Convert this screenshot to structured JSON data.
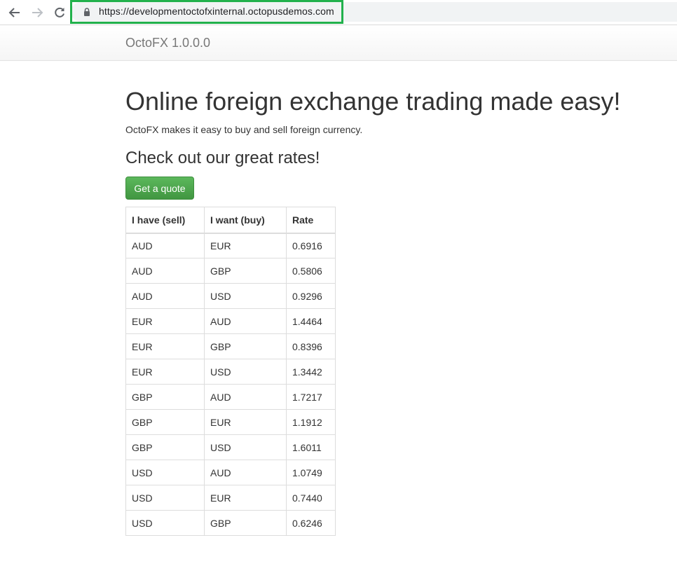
{
  "browser": {
    "url": "https://developmentoctofxinternal.octopusdemos.com",
    "icons": [
      "back-arrow-icon",
      "forward-arrow-icon",
      "reload-icon",
      "lock-icon"
    ]
  },
  "navbar": {
    "brand": "OctoFX 1.0.0.0"
  },
  "hero": {
    "title": "Online foreign exchange trading made easy!",
    "subtitle": "OctoFX makes it easy to buy and sell foreign currency."
  },
  "rates": {
    "heading": "Check out our great rates!",
    "quote_button": "Get a quote",
    "columns": [
      "I have (sell)",
      "I want (buy)",
      "Rate"
    ],
    "rows": [
      [
        "AUD",
        "EUR",
        "0.6916"
      ],
      [
        "AUD",
        "GBP",
        "0.5806"
      ],
      [
        "AUD",
        "USD",
        "0.9296"
      ],
      [
        "EUR",
        "AUD",
        "1.4464"
      ],
      [
        "EUR",
        "GBP",
        "0.8396"
      ],
      [
        "EUR",
        "USD",
        "1.3442"
      ],
      [
        "GBP",
        "AUD",
        "1.7217"
      ],
      [
        "GBP",
        "EUR",
        "1.1912"
      ],
      [
        "GBP",
        "USD",
        "1.6011"
      ],
      [
        "USD",
        "AUD",
        "1.0749"
      ],
      [
        "USD",
        "EUR",
        "0.7440"
      ],
      [
        "USD",
        "GBP",
        "0.6246"
      ]
    ]
  },
  "colors": {
    "highlight": "#22b14c",
    "button_green": "#5cb85c",
    "table_border": "#dddddd"
  }
}
